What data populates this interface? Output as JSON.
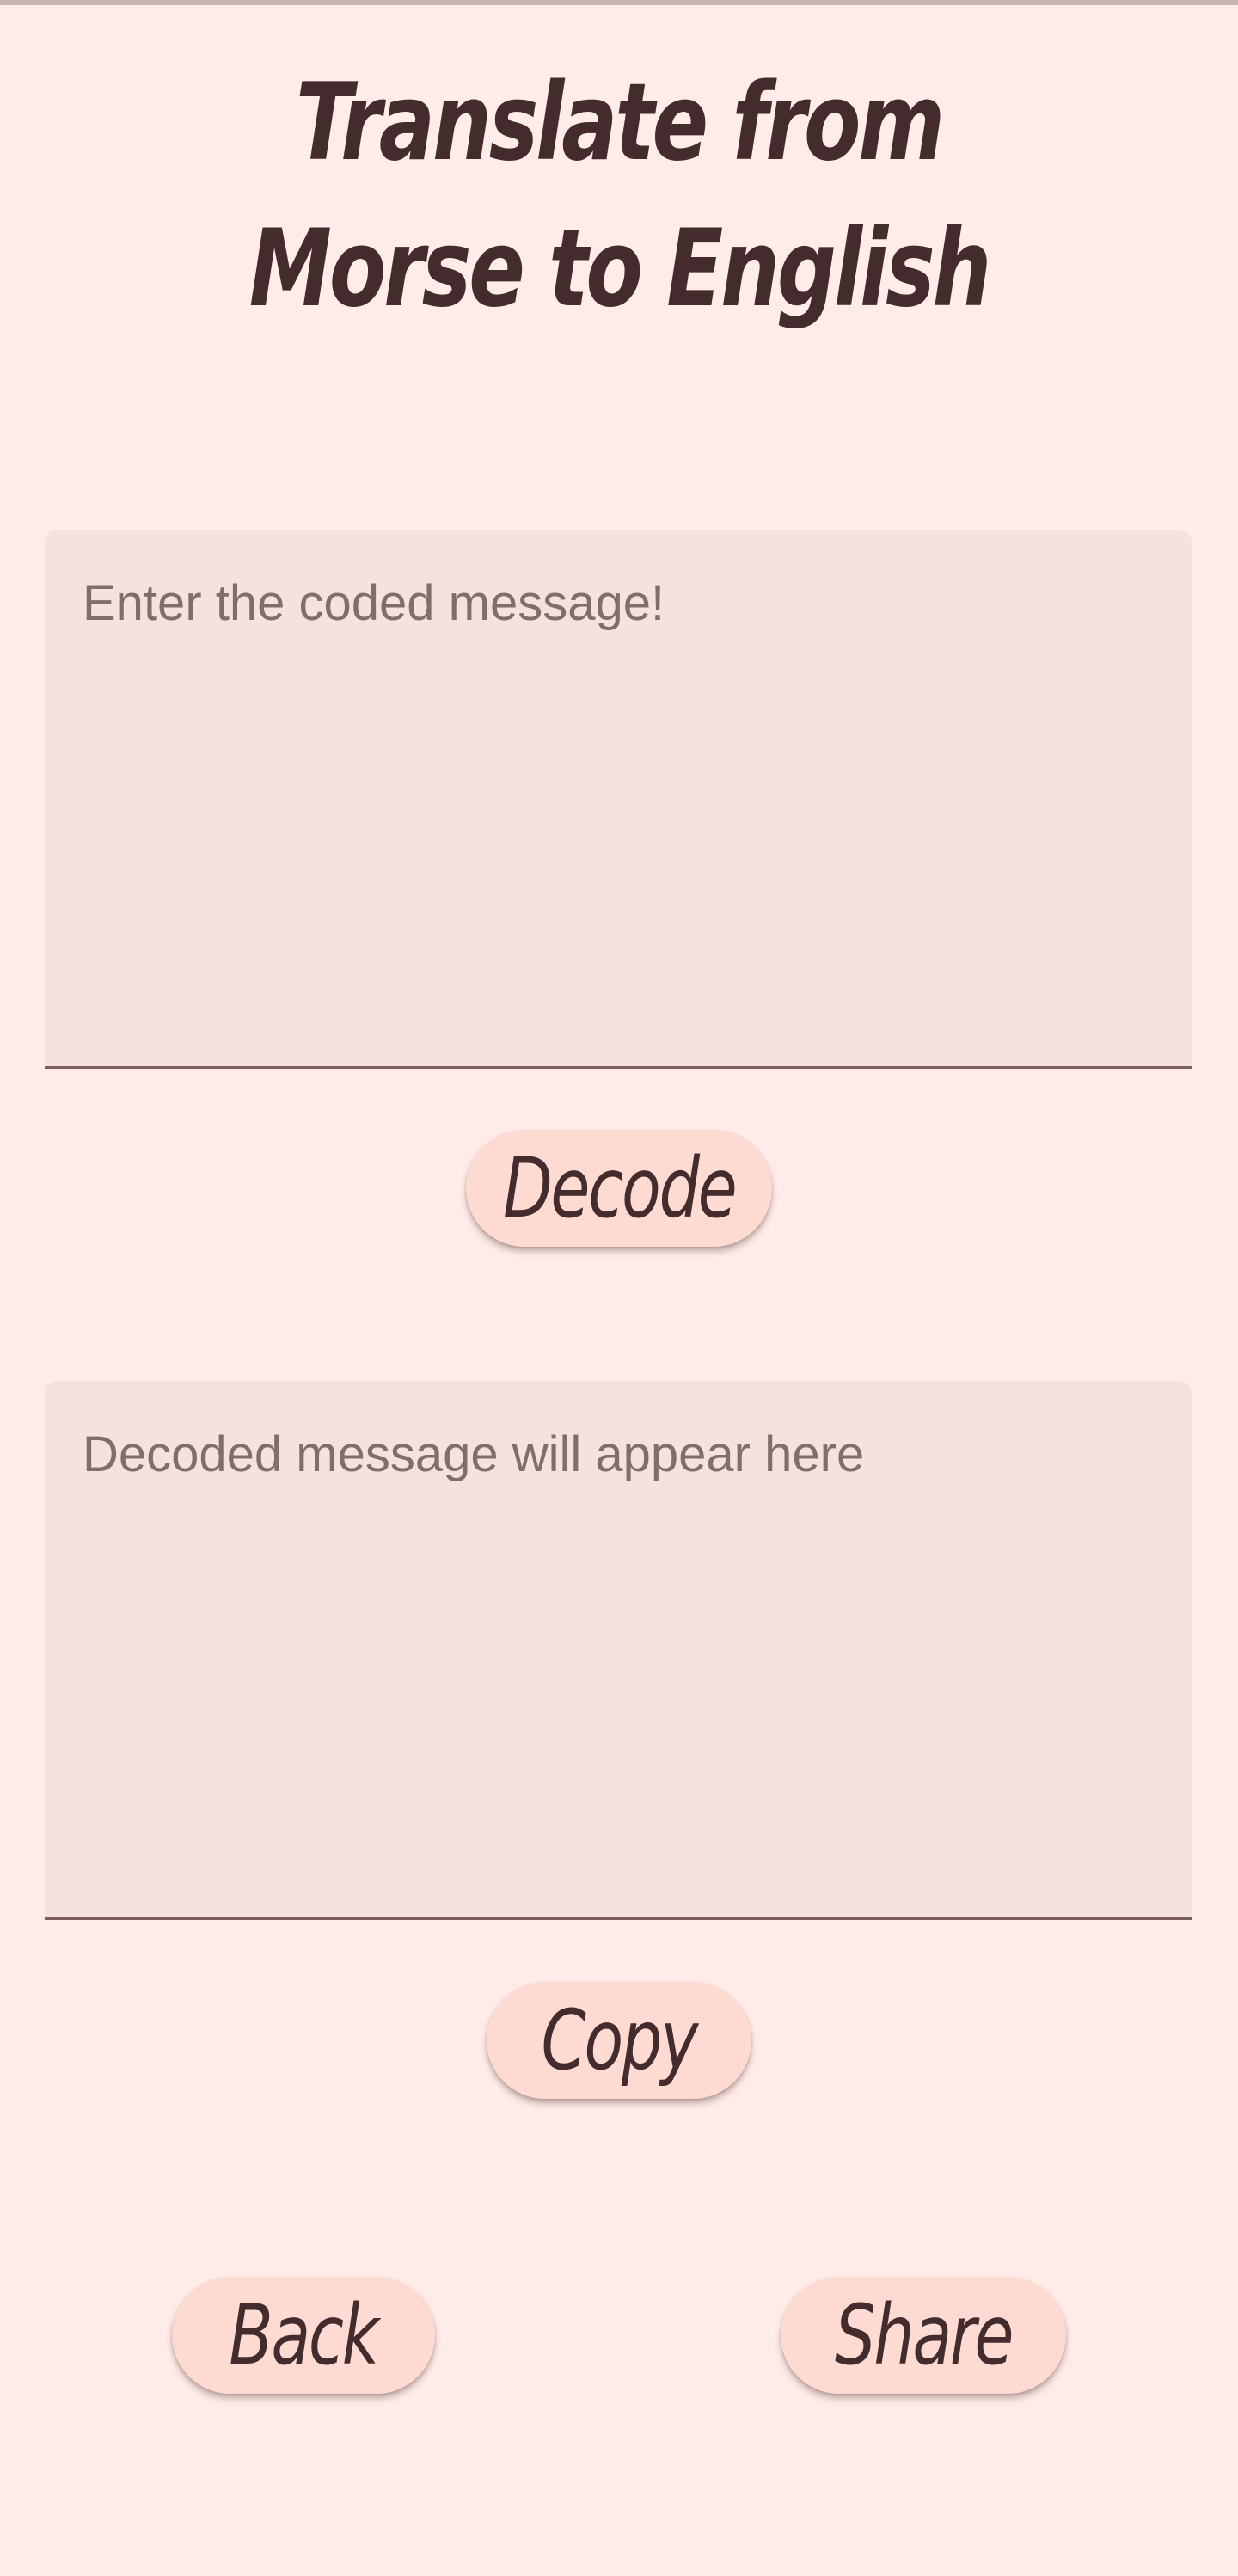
{
  "page": {
    "title": "Translate from Morse to English"
  },
  "input": {
    "placeholder": "Enter the coded message!",
    "value": ""
  },
  "decode_button": {
    "label": "Decode"
  },
  "output": {
    "placeholder": "Decoded message will appear here",
    "value": ""
  },
  "copy_button": {
    "label": "Copy"
  },
  "back_button": {
    "label": "Back"
  },
  "share_button": {
    "label": "Share"
  },
  "colors": {
    "background": "#FFECE8",
    "field_fill": "#F5E1DE",
    "button_fill": "#FDDBD2",
    "text": "#442B2D",
    "underline": "#7A5E57"
  }
}
